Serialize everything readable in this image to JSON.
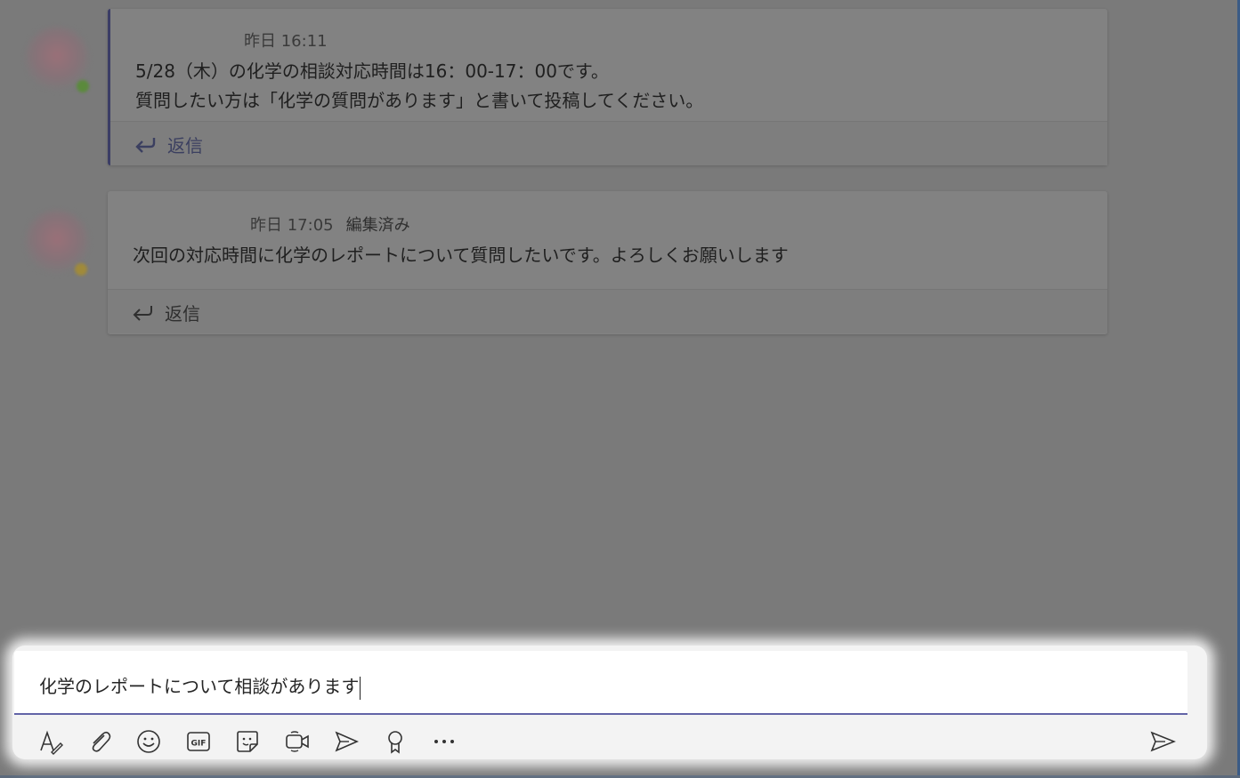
{
  "messages": [
    {
      "timestamp": "昨日 16:11",
      "edited": "",
      "lines": [
        "5/28（木）の化学の相談対応時間は16：00-17：00です。",
        "質問したい方は「化学の質問があります」と書いて投稿してください。"
      ],
      "reply_label": "返信",
      "presence_color": "#5b8a3c"
    },
    {
      "timestamp": "昨日 17:05",
      "edited": "編集済み",
      "lines": [
        "次回の対応時間に化学のレポートについて質問したいです。よろしくお願いします"
      ],
      "reply_label": "返信",
      "presence_color": "#a08a3a"
    }
  ],
  "composer": {
    "value": "化学のレポートについて相談があります",
    "accent_color": "#6264a7"
  },
  "toolbar": {
    "icons": [
      "format-icon",
      "attach-icon",
      "emoji-icon",
      "gif-icon",
      "sticker-icon",
      "meet-now-icon",
      "stream-icon",
      "praise-icon",
      "more-options-icon"
    ],
    "send_icon": "send-icon"
  }
}
